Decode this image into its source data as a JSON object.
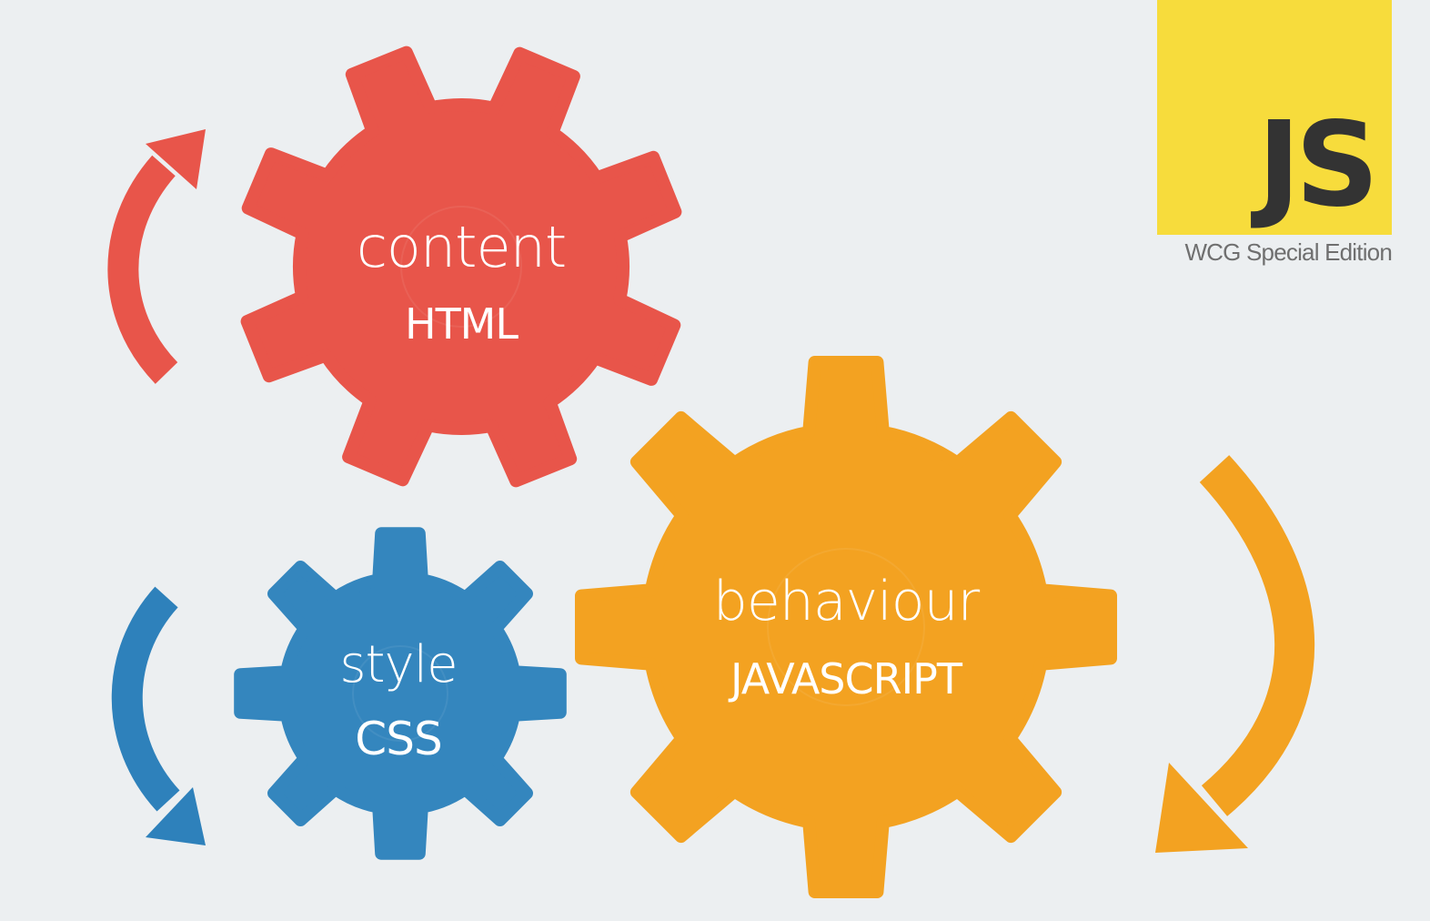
{
  "gears": {
    "content": {
      "word": "content",
      "tech": "HTML",
      "color": "#e8554a"
    },
    "style": {
      "word": "style",
      "tech": "CSS",
      "color": "#3486be"
    },
    "behaviour": {
      "word": "behaviour",
      "tech": "JAVASCRIPT",
      "color": "#f3a221"
    }
  },
  "badge": {
    "logo_text": "JS",
    "logo_background": "#f7dc3c",
    "logo_text_color": "#333333",
    "edition": "WCG Special Edition"
  },
  "arrows": {
    "red_color": "#e8554a",
    "blue_color": "#2e81bb",
    "orange_color": "#f3a221"
  }
}
